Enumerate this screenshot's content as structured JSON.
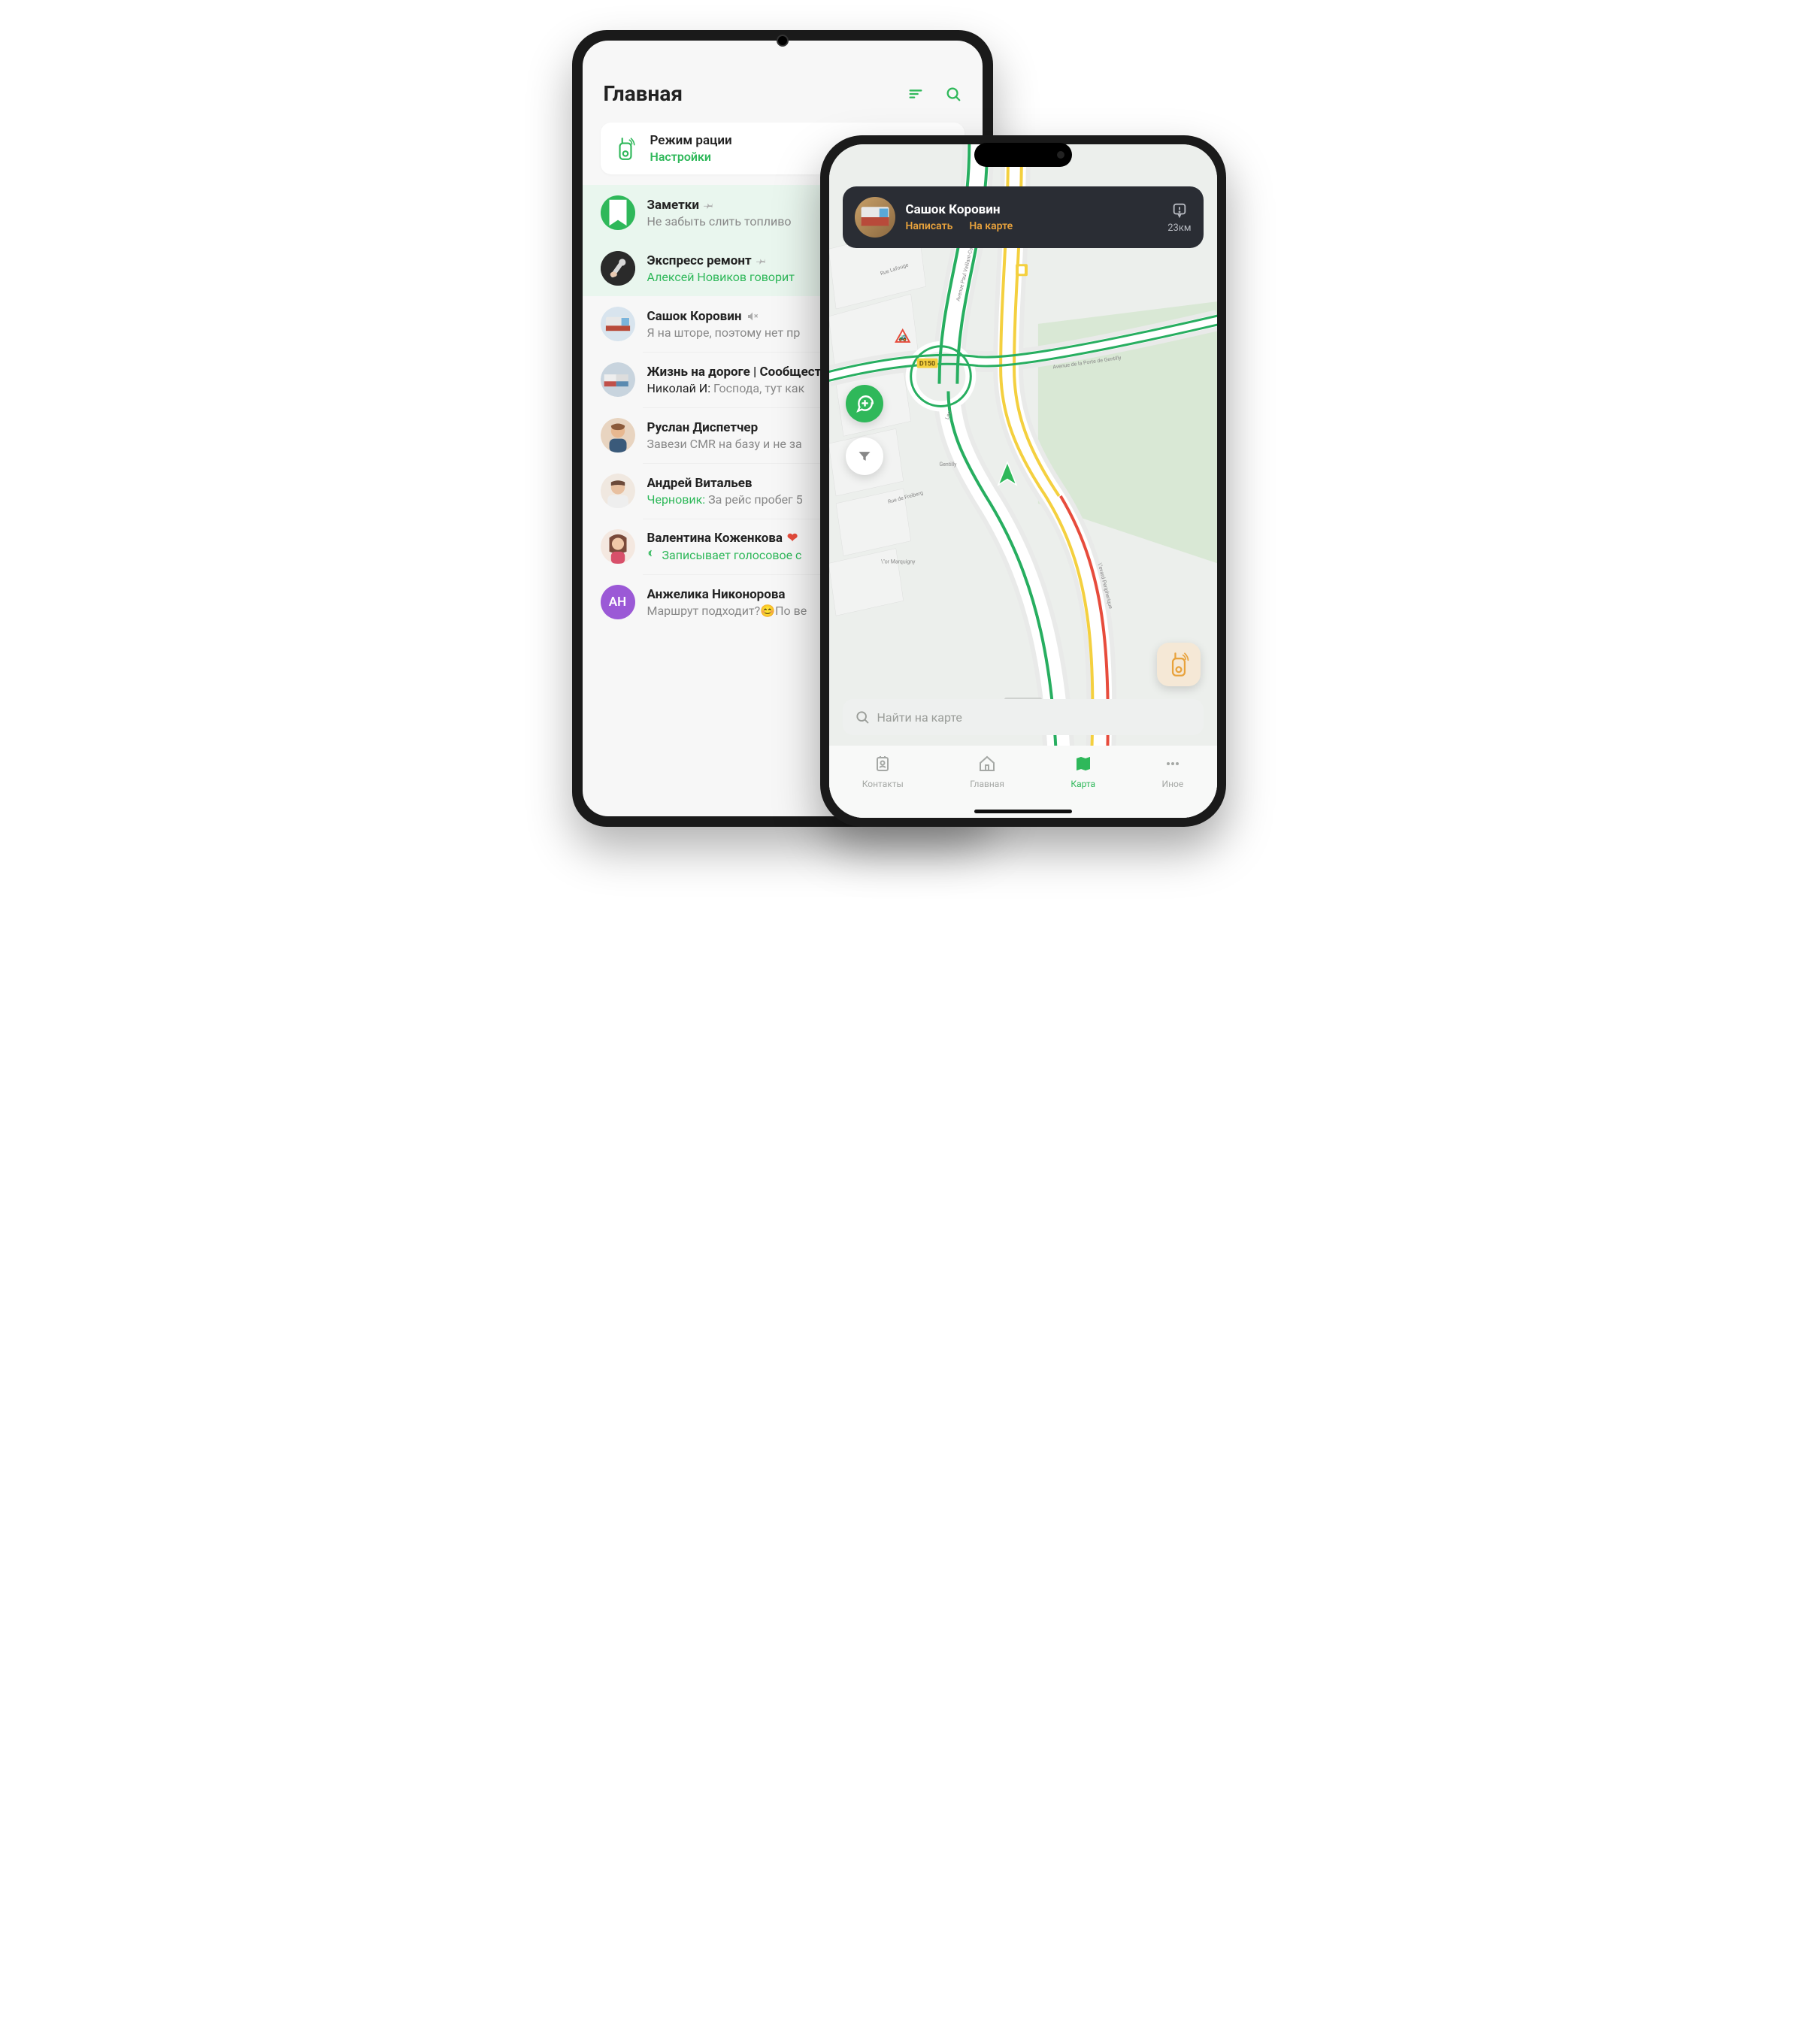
{
  "android": {
    "title": "Главная",
    "radio": {
      "title": "Режим рации",
      "subtitle": "Настройки"
    },
    "chats": [
      {
        "title": "Заметки",
        "sub": "Не забыть слить топливо",
        "pin": true,
        "avatar_bg": "#2fb85a",
        "avatar_kind": "bookmark",
        "selected": true
      },
      {
        "title": "Экспресс ремонт",
        "sub": "Алексей Новиков говорит",
        "sub_green": true,
        "pin": true,
        "avatar_kind": "wrench",
        "selected": true
      },
      {
        "title": "Сашок Коровин",
        "sub": "Я на шторе, поэтому нет пр",
        "mute": true,
        "avatar_kind": "truck"
      },
      {
        "title": "Жизнь на дороге | Сообщест",
        "sub_prefix": "Николай И:",
        "sub": " Господа, тут как",
        "avatar_kind": "trucks2"
      },
      {
        "title": "Руслан Диспетчер",
        "sub": "Завези CMR на базу и не за",
        "avatar_kind": "man1"
      },
      {
        "title": "Андрей Витальев",
        "sub_draft": "Черновик:",
        "sub": " За рейс пробег 5",
        "avatar_kind": "man2"
      },
      {
        "title": "Валентина Коженкова",
        "heart": true,
        "sub": "Записывает голосовое с",
        "sub_green": true,
        "rec": true,
        "avatar_kind": "woman"
      },
      {
        "title": "Анжелика Никонорова",
        "sub": "Маршрут подходит?😊По ве",
        "avatar_bg": "#9b59d6",
        "avatar_kind": "initials",
        "initials": "АН"
      }
    ]
  },
  "iphone": {
    "user": {
      "name": "Сашок Коровин",
      "write": "Написать",
      "on_map": "На карте",
      "distance": "23км"
    },
    "search_placeholder": "Найти на карте",
    "map_labels": {
      "rue_lafouge": "Rue Lafouge",
      "avenue_paul": "Avenue Paul Vaillant-Couturier",
      "avenue_porte": "Avenue de la Porte de Gentilly",
      "gentilly": "Gentilly",
      "rue_freiberg": "Rue de Freiberg",
      "marquigny": "\\\"or Marquigny",
      "peripherique": "\\\"evard Peripherique",
      "d150": "D150",
      "lec": "Lec"
    },
    "tabs": [
      {
        "label": "Контакты",
        "icon": "contacts"
      },
      {
        "label": "Главная",
        "icon": "home"
      },
      {
        "label": "Карта",
        "icon": "map",
        "active": true
      },
      {
        "label": "Иное",
        "icon": "more"
      }
    ]
  }
}
